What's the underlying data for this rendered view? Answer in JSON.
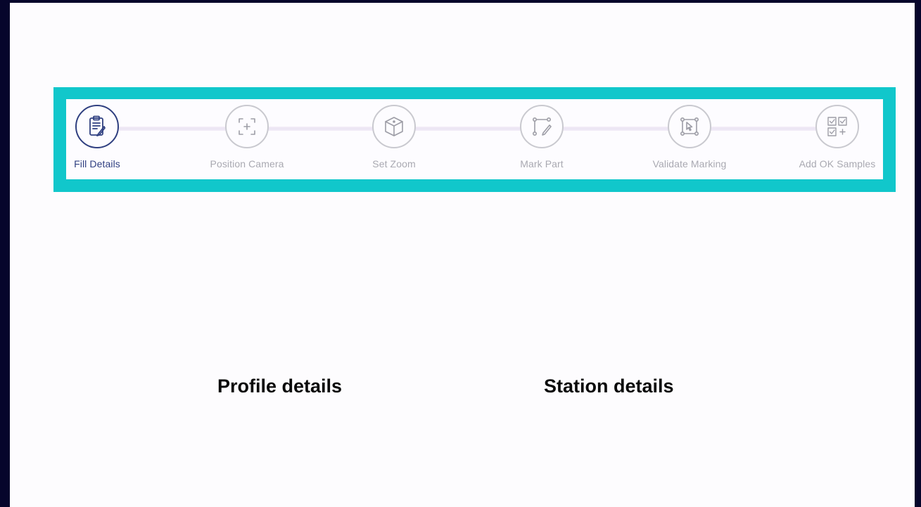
{
  "stepper": {
    "steps": [
      {
        "label": "Fill Details",
        "icon": "clipboard-pencil-icon",
        "active": true
      },
      {
        "label": "Position Camera",
        "icon": "camera-frame-icon",
        "active": false
      },
      {
        "label": "Set Zoom",
        "icon": "cube-icon",
        "active": false
      },
      {
        "label": "Mark Part",
        "icon": "polygon-pencil-icon",
        "active": false
      },
      {
        "label": "Validate Marking",
        "icon": "marking-cursor-icon",
        "active": false
      },
      {
        "label": "Add OK Samples",
        "icon": "samples-grid-icon",
        "active": false
      }
    ]
  },
  "sections": {
    "profile_title": "Profile details",
    "station_title": "Station details"
  },
  "colors": {
    "accent_border": "#11c7cb",
    "active_step": "#2f3f80",
    "inactive_step": "#a9a9b1",
    "background": "#06052b"
  }
}
